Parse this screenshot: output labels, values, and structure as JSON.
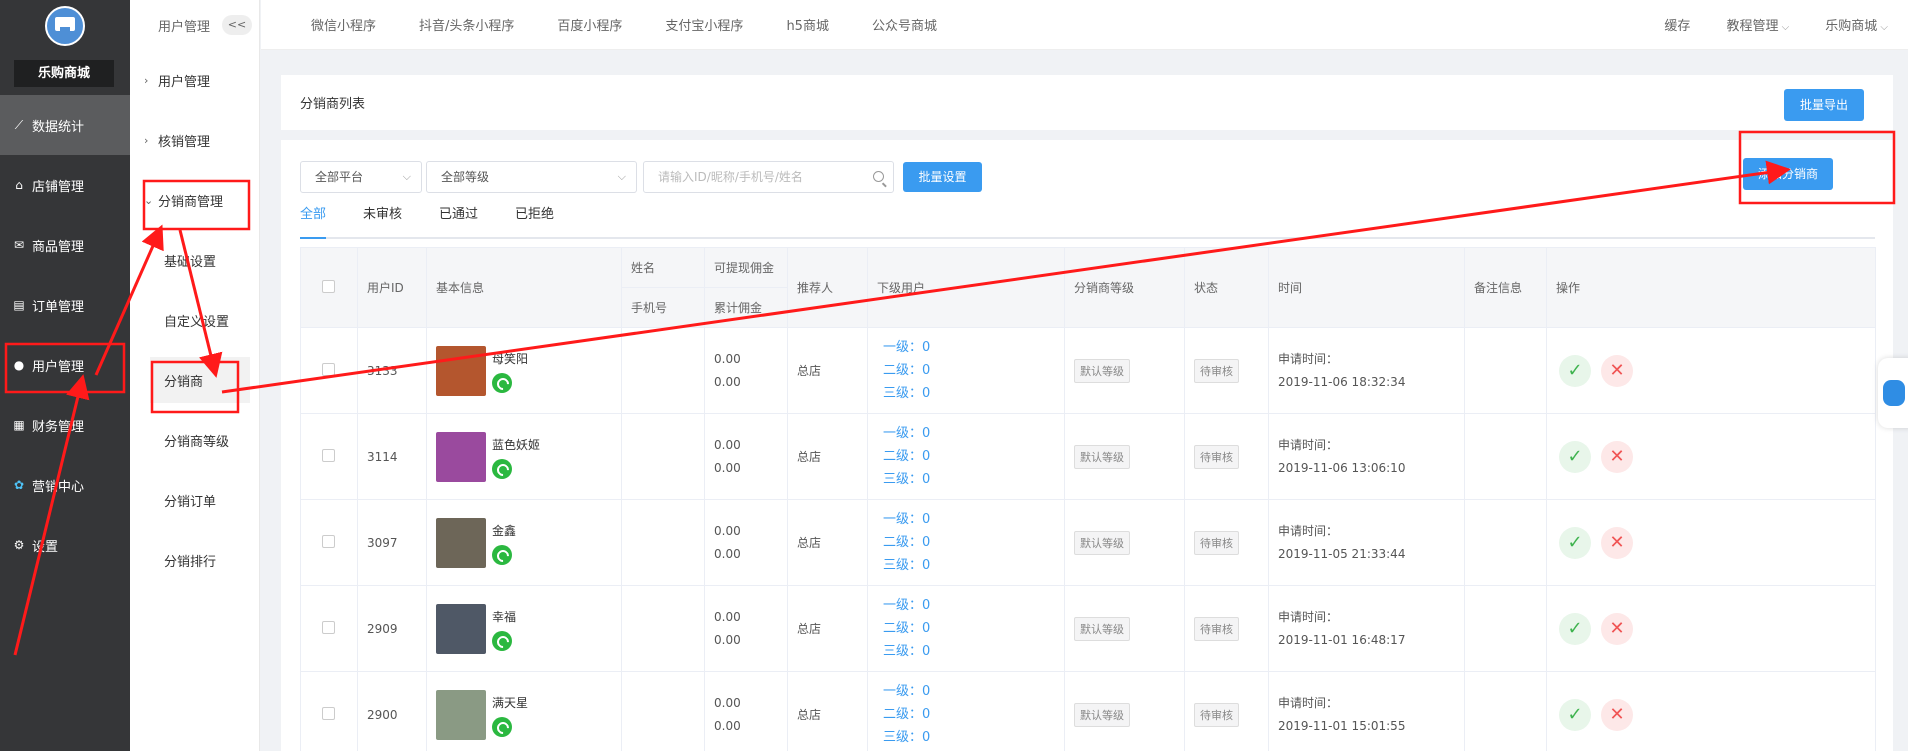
{
  "brand": {
    "name": "乐购商城"
  },
  "side1": {
    "items": [
      {
        "label": "数据统计",
        "icon": "chart-icon"
      },
      {
        "label": "店铺管理",
        "icon": "store-icon"
      },
      {
        "label": "商品管理",
        "icon": "goods-icon"
      },
      {
        "label": "订单管理",
        "icon": "order-icon"
      },
      {
        "label": "用户管理",
        "icon": "user-icon"
      },
      {
        "label": "财务管理",
        "icon": "finance-icon"
      },
      {
        "label": "营销中心",
        "icon": "marketing-icon"
      },
      {
        "label": "设置",
        "icon": "gear-icon"
      }
    ]
  },
  "side2": {
    "header": "用户管理",
    "collapse": "<<",
    "groups": [
      "用户管理",
      "核销管理",
      "分销商管理"
    ],
    "subs": [
      "基础设置",
      "自定义设置",
      "分销商",
      "分销商等级",
      "分销订单",
      "分销排行"
    ]
  },
  "topbar": {
    "tabs": [
      "微信小程序",
      "抖音/头条小程序",
      "百度小程序",
      "支付宝小程序",
      "h5商城",
      "公众号商城"
    ],
    "cache": "缓存",
    "tutorial": "教程管理",
    "shop": "乐购商城"
  },
  "list_head": {
    "title": "分销商列表",
    "export": "批量导出"
  },
  "filters": {
    "platform": "全部平台",
    "level": "全部等级",
    "search_placeholder": "请输入ID/昵称/手机号/姓名",
    "batch": "批量设置",
    "add": "添加分销商"
  },
  "status_tabs": [
    "全部",
    "未审核",
    "已通过",
    "已拒绝"
  ],
  "table": {
    "headers": {
      "uid": "用户ID",
      "info": "基本信息",
      "name": "姓名",
      "phone": "手机号",
      "withdrawable": "可提现佣金",
      "total": "累计佣金",
      "referrer": "推荐人",
      "subs": "下级用户",
      "level": "分销商等级",
      "status": "状态",
      "time": "时间",
      "remark": "备注信息",
      "ops": "操作"
    },
    "rows": [
      {
        "id": "3133",
        "nick": "母笑阳",
        "w": "0.00",
        "t": "0.00",
        "ref": "总店",
        "l1": "一级：0",
        "l2": "二级：0",
        "l3": "三级：0",
        "level": "默认等级",
        "status": "待审核",
        "time_label": "申请时间：",
        "time": "2019-11-06 18:32:34",
        "thumb": "#b4562e"
      },
      {
        "id": "3114",
        "nick": "蓝色妖姬",
        "w": "0.00",
        "t": "0.00",
        "ref": "总店",
        "l1": "一级：0",
        "l2": "二级：0",
        "l3": "三级：0",
        "level": "默认等级",
        "status": "待审核",
        "time_label": "申请时间：",
        "time": "2019-11-06 13:06:10",
        "thumb": "#9a4a9e"
      },
      {
        "id": "3097",
        "nick": "金鑫",
        "w": "0.00",
        "t": "0.00",
        "ref": "总店",
        "l1": "一级：0",
        "l2": "二级：0",
        "l3": "三级：0",
        "level": "默认等级",
        "status": "待审核",
        "time_label": "申请时间：",
        "time": "2019-11-05 21:33:44",
        "thumb": "#6d6658"
      },
      {
        "id": "2909",
        "nick": "幸福",
        "w": "0.00",
        "t": "0.00",
        "ref": "总店",
        "l1": "一级：0",
        "l2": "二级：0",
        "l3": "三级：0",
        "level": "默认等级",
        "status": "待审核",
        "time_label": "申请时间：",
        "time": "2019-11-01 16:48:17",
        "thumb": "#4f5866"
      },
      {
        "id": "2900",
        "nick": "满天星",
        "w": "0.00",
        "t": "0.00",
        "ref": "总店",
        "l1": "一级：0",
        "l2": "二级：0",
        "l3": "三级：0",
        "level": "默认等级",
        "status": "待审核",
        "time_label": "申请时间：",
        "time": "2019-11-01 15:01:55",
        "thumb": "#8a9a84"
      }
    ]
  },
  "colors": {
    "accent": "#3a9bf0",
    "sidebar": "#353638",
    "annotation": "#ff1a1a"
  }
}
